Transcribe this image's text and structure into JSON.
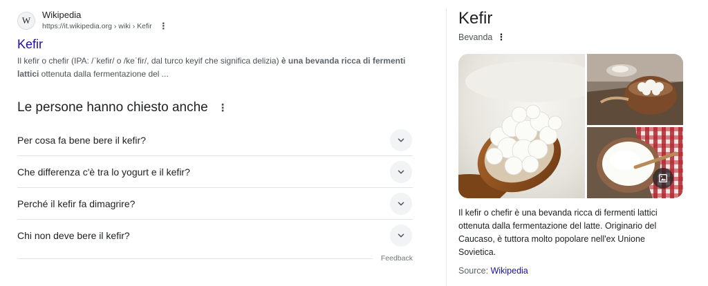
{
  "result": {
    "favicon_letter": "W",
    "site_name": "Wikipedia",
    "url": "https://it.wikipedia.org › wiki › Kefir",
    "title": "Kefir",
    "snippet_plain": "Il kefir o chefir (IPA: /ˈkefir/ o /keˈfir/, dal turco keyif che significa delizia) ",
    "snippet_bold": "è una bevanda ricca di fermenti lattici",
    "snippet_tail": " ottenuta dalla fermentazione del ..."
  },
  "paa": {
    "title": "Le persone hanno chiesto anche",
    "questions": [
      "Per cosa fa bene bere il kefir?",
      "Che differenza c'è tra lo yogurt e il kefir?",
      "Perché il kefir fa dimagrire?",
      "Chi non deve bere il kefir?"
    ],
    "feedback": "Feedback"
  },
  "knowledge_panel": {
    "title": "Kefir",
    "subtitle": "Bevanda",
    "description": "Il kefir o chefir è una bevanda ricca di fermenti lattici ottenuta dalla fermentazione del latte. Originario del Caucaso, è tuttora molto popolare nell'ex Unione Sovietica.",
    "source_label": "Source: ",
    "source_link": "Wikipedia"
  },
  "icons": {
    "favicon": "wikipedia-logo-icon",
    "more": "three-dots-vertical-icon",
    "expand": "chevron-down-icon",
    "gallery": "image-gallery-icon"
  },
  "colors": {
    "link": "#1a0dab",
    "text": "#202124",
    "secondary": "#4d5156"
  }
}
